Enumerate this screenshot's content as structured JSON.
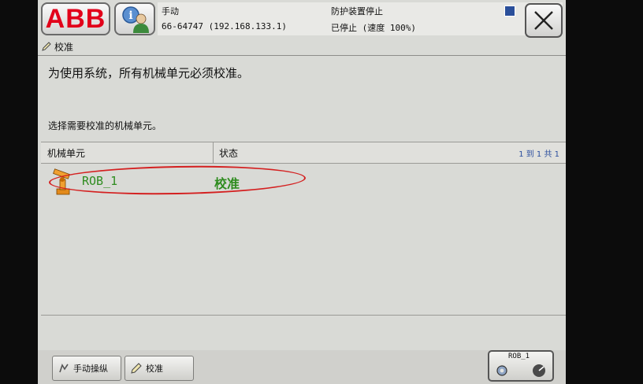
{
  "header": {
    "logo": "ABB",
    "mode": "手动",
    "controller": "66-64747 (192.168.133.1)",
    "safety_state": "防护装置停止",
    "run_state": "已停止 (速度 100%)"
  },
  "breadcrumb": {
    "label": "校准"
  },
  "content": {
    "main_message": "为使用系统，所有机械单元必须校准。",
    "select_message": "选择需要校准的机械单元。"
  },
  "table": {
    "columns": [
      "机械单元",
      "状态"
    ],
    "pagination": "1 到 1 共 1",
    "rows": [
      {
        "unit": "ROB_1",
        "status": "校准"
      }
    ]
  },
  "taskbar": {
    "tasks": [
      {
        "label": "手动操纵"
      },
      {
        "label": "校准"
      }
    ],
    "quickset_label": "ROB_1"
  },
  "colors": {
    "abb_red": "#e2001a",
    "status_green": "#2f8c1f",
    "annotation_red": "#d42020"
  }
}
